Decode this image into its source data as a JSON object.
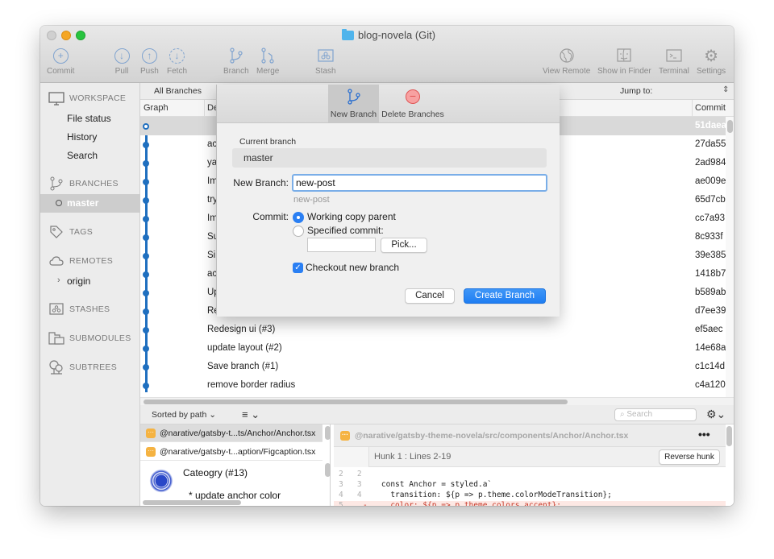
{
  "window": {
    "title": "blog-novela (Git)"
  },
  "toolbar": {
    "commit": "Commit",
    "pull": "Pull",
    "push": "Push",
    "fetch": "Fetch",
    "branch": "Branch",
    "merge": "Merge",
    "stash": "Stash",
    "view_remote": "View Remote",
    "show_in_finder": "Show in Finder",
    "terminal": "Terminal",
    "settings": "Settings"
  },
  "sidebar": {
    "workspace": "WORKSPACE",
    "workspace_items": [
      "File status",
      "History",
      "Search"
    ],
    "branches": "BRANCHES",
    "current_branch": "master",
    "tags": "TAGS",
    "remotes": "REMOTES",
    "remote_items": [
      "origin"
    ],
    "stashes": "STASHES",
    "submodules": "SUBMODULES",
    "subtrees": "SUBTREES"
  },
  "history": {
    "branch_filter": "All Branches",
    "jump_to": "Jump to:",
    "columns": {
      "graph": "Graph",
      "description": "De",
      "commit": "Commit"
    },
    "rows": [
      {
        "desc": "",
        "hash": "51daea"
      },
      {
        "desc": "ac",
        "hash": "27da55"
      },
      {
        "desc": "ya",
        "hash": "2ad984"
      },
      {
        "desc": "Im",
        "hash": "ae009e"
      },
      {
        "desc": "try",
        "hash": "65d7cb"
      },
      {
        "desc": "Im",
        "hash": "cc7a93"
      },
      {
        "desc": "Su",
        "hash": "8c933f"
      },
      {
        "desc": "Si",
        "hash": "39e385"
      },
      {
        "desc": "ac",
        "hash": "1418b7"
      },
      {
        "desc": "Up",
        "hash": "b589ab"
      },
      {
        "desc": "Re",
        "hash": "d7ee39"
      },
      {
        "desc": "Redesign ui (#3)",
        "hash": "ef5aec"
      },
      {
        "desc": "update layout (#2)",
        "hash": "14e68a"
      },
      {
        "desc": "Save branch (#1)",
        "hash": "c1c14d"
      },
      {
        "desc": "remove border radius",
        "hash": "c4a120"
      }
    ]
  },
  "bottom": {
    "sorted_by": "Sorted by path",
    "search_placeholder": "Search",
    "files": [
      "@narative/gatsby-t...ts/Anchor/Anchor.tsx",
      "@narative/gatsby-t...aption/Figcaption.tsx"
    ],
    "commit_title": "Cateogry (#13)",
    "commit_message": "* update anchor color",
    "diff_file": "@narative/gatsby-theme-novela/src/components/Anchor/Anchor.tsx",
    "hunk_title": "Hunk 1 : Lines 2-19",
    "reverse_hunk": "Reverse hunk",
    "code_lines": [
      {
        "old": "2",
        "new": "2",
        "prefix": " ",
        "text": "",
        "type": "context"
      },
      {
        "old": "3",
        "new": "3",
        "prefix": " ",
        "text": "const Anchor = styled.a`",
        "type": "context"
      },
      {
        "old": "4",
        "new": "4",
        "prefix": " ",
        "text": "  transition: ${p => p.theme.colorModeTransition};",
        "type": "context"
      },
      {
        "old": "5",
        "new": "",
        "prefix": "-",
        "text": "  color: ${p => p.theme.colors.accent};",
        "type": "deleted"
      }
    ]
  },
  "dialog": {
    "tab_new_branch": "New Branch",
    "tab_delete_branches": "Delete Branches",
    "current_branch_label": "Current branch",
    "current_branch_value": "master",
    "new_branch_label": "New Branch:",
    "new_branch_value": "new-post",
    "new_branch_hint": "new-post",
    "commit_label": "Commit:",
    "opt_working_copy": "Working copy parent",
    "opt_specified": "Specified commit:",
    "specified_value": "",
    "pick": "Pick...",
    "checkout_label": "Checkout new branch",
    "checkout_checked": true,
    "selected_option": "Working copy parent",
    "cancel": "Cancel",
    "create": "Create Branch"
  },
  "colors": {
    "accent": "#2a7ff3",
    "graph": "#1f6fbf",
    "delete": "#e05454",
    "file_badge": "#f5b342"
  }
}
